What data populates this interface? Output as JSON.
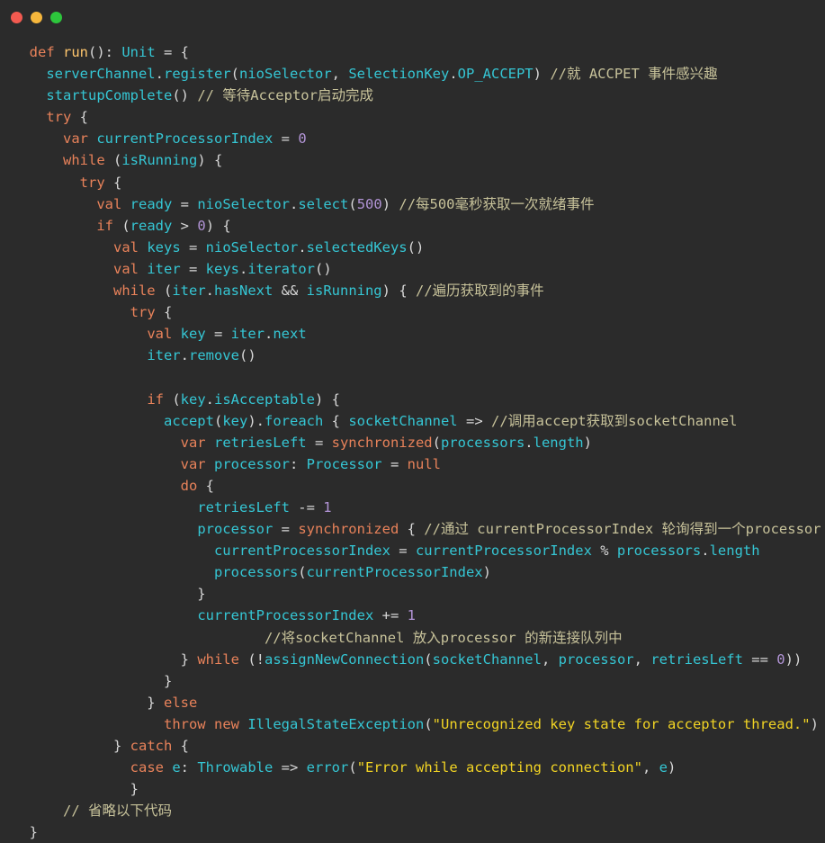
{
  "window": {
    "title_bar": {
      "buttons": [
        {
          "name": "close",
          "icon": "close-dot-icon",
          "color": "#f25a50"
        },
        {
          "name": "minimize",
          "icon": "minimize-dot-icon",
          "color": "#f6b73c"
        },
        {
          "name": "maximize",
          "icon": "maximize-dot-icon",
          "color": "#2dc63c"
        }
      ]
    },
    "background": "#2b2b2b"
  },
  "editor": {
    "language": "scala",
    "theme": "darcula",
    "colors": {
      "background": "#2b2b2b",
      "keyword": "#e8825a",
      "function": "#ffc66d",
      "identifier": "#35c6d4",
      "comment": "#c7c29a",
      "string": "#f2d424",
      "number": "#b294d6",
      "punctuation": "#d8d8d8"
    },
    "code_lines": [
      [
        {
          "t": "  ",
          "c": "pn"
        },
        {
          "t": "def",
          "c": "kw"
        },
        {
          "t": " ",
          "c": "pn"
        },
        {
          "t": "run",
          "c": "fn"
        },
        {
          "t": "(): ",
          "c": "pn"
        },
        {
          "t": "Unit",
          "c": "ty"
        },
        {
          "t": " = {",
          "c": "pn"
        }
      ],
      [
        {
          "t": "    ",
          "c": "pn"
        },
        {
          "t": "serverChannel",
          "c": "id"
        },
        {
          "t": ".",
          "c": "pn"
        },
        {
          "t": "register",
          "c": "id"
        },
        {
          "t": "(",
          "c": "pn"
        },
        {
          "t": "nioSelector",
          "c": "id"
        },
        {
          "t": ", ",
          "c": "pn"
        },
        {
          "t": "SelectionKey",
          "c": "id"
        },
        {
          "t": ".",
          "c": "pn"
        },
        {
          "t": "OP_ACCEPT",
          "c": "id"
        },
        {
          "t": ") ",
          "c": "pn"
        },
        {
          "t": "//就 ACCPET 事件感兴趣",
          "c": "cm"
        }
      ],
      [
        {
          "t": "    ",
          "c": "pn"
        },
        {
          "t": "startupComplete",
          "c": "id"
        },
        {
          "t": "() ",
          "c": "pn"
        },
        {
          "t": "// 等待Acceptor启动完成",
          "c": "cm"
        }
      ],
      [
        {
          "t": "    ",
          "c": "pn"
        },
        {
          "t": "try",
          "c": "kw"
        },
        {
          "t": " {",
          "c": "pn"
        }
      ],
      [
        {
          "t": "      ",
          "c": "pn"
        },
        {
          "t": "var",
          "c": "kw"
        },
        {
          "t": " ",
          "c": "pn"
        },
        {
          "t": "currentProcessorIndex",
          "c": "id"
        },
        {
          "t": " = ",
          "c": "pn"
        },
        {
          "t": "0",
          "c": "num"
        }
      ],
      [
        {
          "t": "      ",
          "c": "pn"
        },
        {
          "t": "while",
          "c": "kw"
        },
        {
          "t": " (",
          "c": "pn"
        },
        {
          "t": "isRunning",
          "c": "id"
        },
        {
          "t": ") {",
          "c": "pn"
        }
      ],
      [
        {
          "t": "        ",
          "c": "pn"
        },
        {
          "t": "try",
          "c": "kw"
        },
        {
          "t": " {",
          "c": "pn"
        }
      ],
      [
        {
          "t": "          ",
          "c": "pn"
        },
        {
          "t": "val",
          "c": "kw"
        },
        {
          "t": " ",
          "c": "pn"
        },
        {
          "t": "ready",
          "c": "id"
        },
        {
          "t": " = ",
          "c": "pn"
        },
        {
          "t": "nioSelector",
          "c": "id"
        },
        {
          "t": ".",
          "c": "pn"
        },
        {
          "t": "select",
          "c": "id"
        },
        {
          "t": "(",
          "c": "pn"
        },
        {
          "t": "500",
          "c": "num"
        },
        {
          "t": ") ",
          "c": "pn"
        },
        {
          "t": "//每500毫秒获取一次就绪事件",
          "c": "cm"
        }
      ],
      [
        {
          "t": "          ",
          "c": "pn"
        },
        {
          "t": "if",
          "c": "kw"
        },
        {
          "t": " (",
          "c": "pn"
        },
        {
          "t": "ready",
          "c": "id"
        },
        {
          "t": " > ",
          "c": "pn"
        },
        {
          "t": "0",
          "c": "num"
        },
        {
          "t": ") {",
          "c": "pn"
        }
      ],
      [
        {
          "t": "            ",
          "c": "pn"
        },
        {
          "t": "val",
          "c": "kw"
        },
        {
          "t": " ",
          "c": "pn"
        },
        {
          "t": "keys",
          "c": "id"
        },
        {
          "t": " = ",
          "c": "pn"
        },
        {
          "t": "nioSelector",
          "c": "id"
        },
        {
          "t": ".",
          "c": "pn"
        },
        {
          "t": "selectedKeys",
          "c": "id"
        },
        {
          "t": "()",
          "c": "pn"
        }
      ],
      [
        {
          "t": "            ",
          "c": "pn"
        },
        {
          "t": "val",
          "c": "kw"
        },
        {
          "t": " ",
          "c": "pn"
        },
        {
          "t": "iter",
          "c": "id"
        },
        {
          "t": " = ",
          "c": "pn"
        },
        {
          "t": "keys",
          "c": "id"
        },
        {
          "t": ".",
          "c": "pn"
        },
        {
          "t": "iterator",
          "c": "id"
        },
        {
          "t": "()",
          "c": "pn"
        }
      ],
      [
        {
          "t": "            ",
          "c": "pn"
        },
        {
          "t": "while",
          "c": "kw"
        },
        {
          "t": " (",
          "c": "pn"
        },
        {
          "t": "iter",
          "c": "id"
        },
        {
          "t": ".",
          "c": "pn"
        },
        {
          "t": "hasNext",
          "c": "id"
        },
        {
          "t": " && ",
          "c": "pn"
        },
        {
          "t": "isRunning",
          "c": "id"
        },
        {
          "t": ") { ",
          "c": "pn"
        },
        {
          "t": "//遍历获取到的事件",
          "c": "cm"
        }
      ],
      [
        {
          "t": "              ",
          "c": "pn"
        },
        {
          "t": "try",
          "c": "kw"
        },
        {
          "t": " {",
          "c": "pn"
        }
      ],
      [
        {
          "t": "                ",
          "c": "pn"
        },
        {
          "t": "val",
          "c": "kw"
        },
        {
          "t": " ",
          "c": "pn"
        },
        {
          "t": "key",
          "c": "id"
        },
        {
          "t": " = ",
          "c": "pn"
        },
        {
          "t": "iter",
          "c": "id"
        },
        {
          "t": ".",
          "c": "pn"
        },
        {
          "t": "next",
          "c": "id"
        }
      ],
      [
        {
          "t": "                ",
          "c": "pn"
        },
        {
          "t": "iter",
          "c": "id"
        },
        {
          "t": ".",
          "c": "pn"
        },
        {
          "t": "remove",
          "c": "id"
        },
        {
          "t": "()",
          "c": "pn"
        }
      ],
      [
        {
          "t": "",
          "c": "pn"
        }
      ],
      [
        {
          "t": "                ",
          "c": "pn"
        },
        {
          "t": "if",
          "c": "kw"
        },
        {
          "t": " (",
          "c": "pn"
        },
        {
          "t": "key",
          "c": "id"
        },
        {
          "t": ".",
          "c": "pn"
        },
        {
          "t": "isAcceptable",
          "c": "id"
        },
        {
          "t": ") {",
          "c": "pn"
        }
      ],
      [
        {
          "t": "                  ",
          "c": "pn"
        },
        {
          "t": "accept",
          "c": "id"
        },
        {
          "t": "(",
          "c": "pn"
        },
        {
          "t": "key",
          "c": "id"
        },
        {
          "t": ").",
          "c": "pn"
        },
        {
          "t": "foreach",
          "c": "id"
        },
        {
          "t": " { ",
          "c": "pn"
        },
        {
          "t": "socketChannel",
          "c": "id"
        },
        {
          "t": " => ",
          "c": "pn"
        },
        {
          "t": "//调用accept获取到socketChannel",
          "c": "cm"
        }
      ],
      [
        {
          "t": "                    ",
          "c": "pn"
        },
        {
          "t": "var",
          "c": "kw"
        },
        {
          "t": " ",
          "c": "pn"
        },
        {
          "t": "retriesLeft",
          "c": "id"
        },
        {
          "t": " = ",
          "c": "pn"
        },
        {
          "t": "synchronized",
          "c": "kw"
        },
        {
          "t": "(",
          "c": "pn"
        },
        {
          "t": "processors",
          "c": "id"
        },
        {
          "t": ".",
          "c": "pn"
        },
        {
          "t": "length",
          "c": "id"
        },
        {
          "t": ")",
          "c": "pn"
        }
      ],
      [
        {
          "t": "                    ",
          "c": "pn"
        },
        {
          "t": "var",
          "c": "kw"
        },
        {
          "t": " ",
          "c": "pn"
        },
        {
          "t": "processor",
          "c": "id"
        },
        {
          "t": ": ",
          "c": "pn"
        },
        {
          "t": "Processor",
          "c": "ty"
        },
        {
          "t": " = ",
          "c": "pn"
        },
        {
          "t": "null",
          "c": "kw"
        }
      ],
      [
        {
          "t": "                    ",
          "c": "pn"
        },
        {
          "t": "do",
          "c": "kw"
        },
        {
          "t": " {",
          "c": "pn"
        }
      ],
      [
        {
          "t": "                      ",
          "c": "pn"
        },
        {
          "t": "retriesLeft",
          "c": "id"
        },
        {
          "t": " -= ",
          "c": "pn"
        },
        {
          "t": "1",
          "c": "num"
        }
      ],
      [
        {
          "t": "                      ",
          "c": "pn"
        },
        {
          "t": "processor",
          "c": "id"
        },
        {
          "t": " = ",
          "c": "pn"
        },
        {
          "t": "synchronized",
          "c": "kw"
        },
        {
          "t": " { ",
          "c": "pn"
        },
        {
          "t": "//通过 currentProcessorIndex 轮询得到一个processor",
          "c": "cm"
        }
      ],
      [
        {
          "t": "                        ",
          "c": "pn"
        },
        {
          "t": "currentProcessorIndex",
          "c": "id"
        },
        {
          "t": " = ",
          "c": "pn"
        },
        {
          "t": "currentProcessorIndex",
          "c": "id"
        },
        {
          "t": " % ",
          "c": "pn"
        },
        {
          "t": "processors",
          "c": "id"
        },
        {
          "t": ".",
          "c": "pn"
        },
        {
          "t": "length",
          "c": "id"
        }
      ],
      [
        {
          "t": "                        ",
          "c": "pn"
        },
        {
          "t": "processors",
          "c": "id"
        },
        {
          "t": "(",
          "c": "pn"
        },
        {
          "t": "currentProcessorIndex",
          "c": "id"
        },
        {
          "t": ")",
          "c": "pn"
        }
      ],
      [
        {
          "t": "                      }",
          "c": "pn"
        }
      ],
      [
        {
          "t": "                      ",
          "c": "pn"
        },
        {
          "t": "currentProcessorIndex",
          "c": "id"
        },
        {
          "t": " += ",
          "c": "pn"
        },
        {
          "t": "1",
          "c": "num"
        }
      ],
      [
        {
          "t": "                              ",
          "c": "pn"
        },
        {
          "t": "//将socketChannel 放入processor 的新连接队列中",
          "c": "cm"
        }
      ],
      [
        {
          "t": "                    } ",
          "c": "pn"
        },
        {
          "t": "while",
          "c": "kw"
        },
        {
          "t": " (!",
          "c": "pn"
        },
        {
          "t": "assignNewConnection",
          "c": "id"
        },
        {
          "t": "(",
          "c": "pn"
        },
        {
          "t": "socketChannel",
          "c": "id"
        },
        {
          "t": ", ",
          "c": "pn"
        },
        {
          "t": "processor",
          "c": "id"
        },
        {
          "t": ", ",
          "c": "pn"
        },
        {
          "t": "retriesLeft",
          "c": "id"
        },
        {
          "t": " == ",
          "c": "pn"
        },
        {
          "t": "0",
          "c": "num"
        },
        {
          "t": "))",
          "c": "pn"
        }
      ],
      [
        {
          "t": "                  }",
          "c": "pn"
        }
      ],
      [
        {
          "t": "                } ",
          "c": "pn"
        },
        {
          "t": "else",
          "c": "kw"
        }
      ],
      [
        {
          "t": "                  ",
          "c": "pn"
        },
        {
          "t": "throw",
          "c": "kw"
        },
        {
          "t": " ",
          "c": "pn"
        },
        {
          "t": "new",
          "c": "kw"
        },
        {
          "t": " ",
          "c": "pn"
        },
        {
          "t": "IllegalStateException",
          "c": "ty"
        },
        {
          "t": "(",
          "c": "pn"
        },
        {
          "t": "\"Unrecognized key state for acceptor thread.\"",
          "c": "str"
        },
        {
          "t": ")",
          "c": "pn"
        }
      ],
      [
        {
          "t": "            } ",
          "c": "pn"
        },
        {
          "t": "catch",
          "c": "kw"
        },
        {
          "t": " {",
          "c": "pn"
        }
      ],
      [
        {
          "t": "              ",
          "c": "pn"
        },
        {
          "t": "case",
          "c": "kw"
        },
        {
          "t": " ",
          "c": "pn"
        },
        {
          "t": "e",
          "c": "id"
        },
        {
          "t": ": ",
          "c": "pn"
        },
        {
          "t": "Throwable",
          "c": "ty"
        },
        {
          "t": " => ",
          "c": "pn"
        },
        {
          "t": "error",
          "c": "id"
        },
        {
          "t": "(",
          "c": "pn"
        },
        {
          "t": "\"Error while accepting connection\"",
          "c": "str"
        },
        {
          "t": ", ",
          "c": "pn"
        },
        {
          "t": "e",
          "c": "id"
        },
        {
          "t": ")",
          "c": "pn"
        }
      ],
      [
        {
          "t": "              }",
          "c": "pn"
        }
      ],
      [
        {
          "t": "      ",
          "c": "pn"
        },
        {
          "t": "// 省略以下代码",
          "c": "cm"
        }
      ],
      [
        {
          "t": "  }",
          "c": "pn"
        }
      ]
    ]
  }
}
